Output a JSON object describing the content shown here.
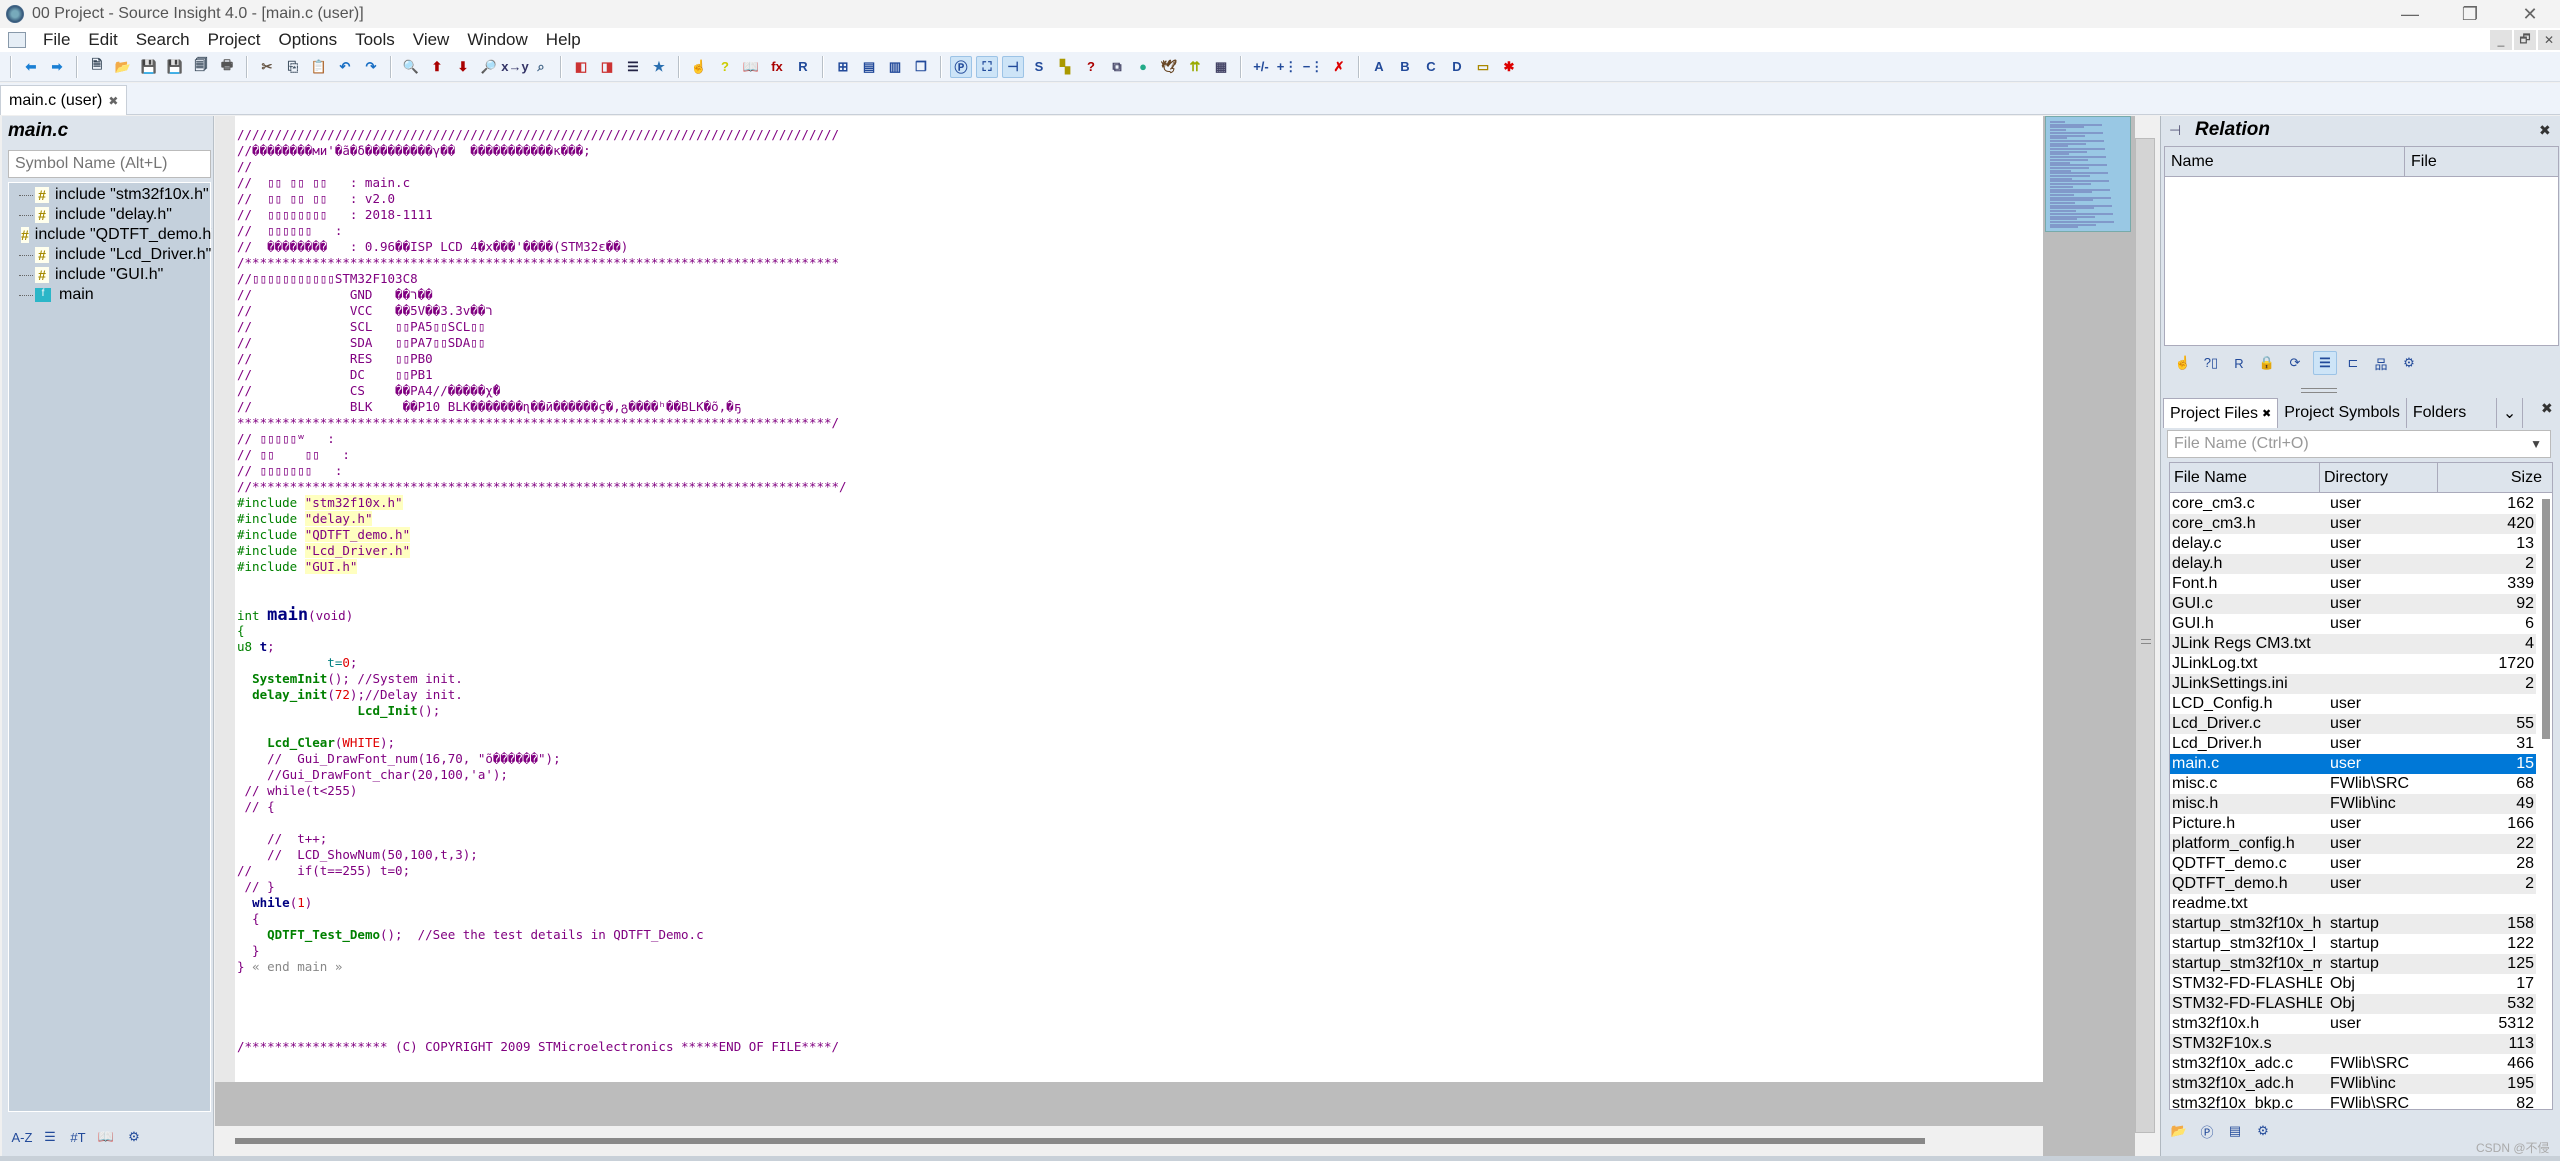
{
  "window": {
    "title": "00 Project - Source Insight 4.0 - [main.c (user)]",
    "controls": {
      "minimize": "—",
      "restore": "❐",
      "close": "✕"
    },
    "mdi_controls": {
      "minimize": "_",
      "restore": "🗗",
      "close": "✕"
    }
  },
  "menu": [
    "File",
    "Edit",
    "Search",
    "Project",
    "Options",
    "Tools",
    "View",
    "Window",
    "Help"
  ],
  "toolbar": {
    "groups": [
      [
        {
          "icon": "back-arrow-icon",
          "glyph": "⬅",
          "color": "#1a7fd4"
        },
        {
          "icon": "forward-arrow-icon",
          "glyph": "➡",
          "color": "#1a7fd4"
        }
      ],
      [
        {
          "icon": "new-file-icon",
          "glyph": "🗎",
          "color": "#345"
        },
        {
          "icon": "open-folder-icon",
          "glyph": "📂",
          "color": "#c90"
        },
        {
          "icon": "save-icon",
          "glyph": "💾",
          "color": "#345"
        },
        {
          "icon": "save-as-icon",
          "glyph": "💾",
          "color": "#a00"
        },
        {
          "icon": "save-all-icon",
          "glyph": "🗐",
          "color": "#345"
        },
        {
          "icon": "print-icon",
          "glyph": "🖶",
          "color": "#555"
        }
      ],
      [
        {
          "icon": "cut-icon",
          "glyph": "✂",
          "color": "#654"
        },
        {
          "icon": "copy-icon",
          "glyph": "⎘",
          "color": "#456"
        },
        {
          "icon": "paste-icon",
          "glyph": "📋",
          "color": "#a80"
        },
        {
          "icon": "undo-icon",
          "glyph": "↶",
          "color": "#1a6fc4"
        },
        {
          "icon": "redo-icon",
          "glyph": "↷",
          "color": "#1a6fc4"
        }
      ],
      [
        {
          "icon": "find-icon",
          "glyph": "🔍",
          "color": "#654"
        },
        {
          "icon": "find-prev-icon",
          "glyph": "⬆",
          "color": "#a00"
        },
        {
          "icon": "find-next-icon",
          "glyph": "⬇",
          "color": "#a00"
        },
        {
          "icon": "search-files-icon",
          "glyph": "🔎",
          "color": "#654"
        },
        {
          "icon": "replace-icon",
          "glyph": "x→y",
          "color": "#336"
        },
        {
          "icon": "search-project-icon",
          "glyph": "⌕",
          "color": "#468"
        }
      ],
      [
        {
          "icon": "bookmark-prev-icon",
          "glyph": "◧",
          "color": "#c33"
        },
        {
          "icon": "bookmark-next-icon",
          "glyph": "◨",
          "color": "#c33"
        },
        {
          "icon": "outline-icon",
          "glyph": "☰",
          "color": "#224"
        },
        {
          "icon": "bookmark-icon",
          "glyph": "★",
          "color": "#2a6fb0"
        }
      ],
      [
        {
          "icon": "jump-to-definition-icon",
          "glyph": "☝",
          "color": "#864"
        },
        {
          "icon": "symbol-info-icon",
          "glyph": "?",
          "color": "#cc0"
        },
        {
          "icon": "browse-icon",
          "glyph": "📖",
          "color": "#654"
        },
        {
          "icon": "function-up-icon",
          "glyph": "fx",
          "color": "#a00"
        },
        {
          "icon": "references-icon",
          "glyph": "R",
          "color": "#224a9a"
        }
      ],
      [
        {
          "icon": "layout-1-icon",
          "glyph": "⊞",
          "color": "#224a9a"
        },
        {
          "icon": "layout-2-icon",
          "glyph": "▤",
          "color": "#224a9a"
        },
        {
          "icon": "layout-3-icon",
          "glyph": "▥",
          "color": "#224a9a"
        },
        {
          "icon": "layout-4-icon",
          "glyph": "❐",
          "color": "#224a9a"
        }
      ],
      [
        {
          "icon": "project-window-icon",
          "glyph": "Ⓟ",
          "color": "#224a9a",
          "active": true
        },
        {
          "icon": "context-window-icon",
          "glyph": "⛶",
          "color": "#224a9a",
          "active": true
        },
        {
          "icon": "relation-window-icon",
          "glyph": "⊣",
          "color": "#224a9a",
          "active": true
        },
        {
          "icon": "symbol-window-icon",
          "glyph": "S",
          "color": "#224a9a"
        },
        {
          "icon": "clip-window-icon",
          "glyph": "▚",
          "color": "#a90"
        },
        {
          "icon": "help-window-icon",
          "glyph": "?",
          "color": "#a00"
        },
        {
          "icon": "overview-icon",
          "glyph": "⧉",
          "color": "#446"
        },
        {
          "icon": "browse-global-icon",
          "glyph": "●",
          "color": "#2a8"
        },
        {
          "icon": "bird-icon",
          "glyph": "🕊",
          "color": "#642"
        },
        {
          "icon": "compare-icon",
          "glyph": "⇈",
          "color": "#9a0"
        },
        {
          "icon": "diff-icon",
          "glyph": "▦",
          "color": "#446"
        }
      ],
      [
        {
          "icon": "expand-collapse-icon",
          "glyph": "+/-",
          "color": "#224a9a"
        },
        {
          "icon": "expand-icon",
          "glyph": "+⋮",
          "color": "#224a9a"
        },
        {
          "icon": "collapse-icon",
          "glyph": "−⋮",
          "color": "#224a9a"
        },
        {
          "icon": "delete-outline-icon",
          "glyph": "✗",
          "color": "#d00"
        }
      ],
      [
        {
          "icon": "bookmark-a-icon",
          "glyph": "A",
          "color": "#224a9a"
        },
        {
          "icon": "bookmark-b-icon",
          "glyph": "B",
          "color": "#224a9a"
        },
        {
          "icon": "bookmark-c-icon",
          "glyph": "C",
          "color": "#224a9a"
        },
        {
          "icon": "bookmark-d-icon",
          "glyph": "D",
          "color": "#224a9a"
        },
        {
          "icon": "folder-bookmark-icon",
          "glyph": "▭",
          "color": "#a80"
        },
        {
          "icon": "folder-bookmark-new-icon",
          "glyph": "✱",
          "color": "#d00"
        }
      ]
    ]
  },
  "tabs": [
    {
      "label": "main.c (user)",
      "close": "✖"
    }
  ],
  "symbol_panel": {
    "title": "main.c",
    "search_placeholder": "Symbol Name (Alt+L)",
    "items": [
      {
        "type": "include",
        "label": "include \"stm32f10x.h\""
      },
      {
        "type": "include",
        "label": "include \"delay.h\""
      },
      {
        "type": "include",
        "label": "include \"QDTFT_demo.h\""
      },
      {
        "type": "include",
        "label": "include \"Lcd_Driver.h\""
      },
      {
        "type": "include",
        "label": "include \"GUI.h\""
      },
      {
        "type": "function",
        "label": "main"
      }
    ],
    "bottom_tools": [
      {
        "icon": "sort-az-icon",
        "glyph": "A-Z"
      },
      {
        "icon": "list-view-icon",
        "glyph": "☰"
      },
      {
        "icon": "symbol-types-icon",
        "glyph": "#T"
      },
      {
        "icon": "browse-book-icon",
        "glyph": "📖"
      },
      {
        "icon": "settings-gear-icon",
        "glyph": "⚙"
      }
    ]
  },
  "editor": {
    "lines": [
      [
        {
          "c": "cmt",
          "t": "////////////////////////////////////////////////////////////////////////////////"
        }
      ],
      [
        {
          "c": "cmt",
          "t": "//��������ми'�ã�δ���������γ��  �����������κ���;"
        }
      ],
      [
        {
          "c": "cmt",
          "t": "//"
        }
      ],
      [
        {
          "c": "cmt",
          "t": "//  ▯▯ ▯▯ ▯▯   : main.c"
        }
      ],
      [
        {
          "c": "cmt",
          "t": "//  ▯▯ ▯▯ ▯▯   : v2.0"
        }
      ],
      [
        {
          "c": "cmt",
          "t": "//  ▯▯▯▯▯▯▯▯   : 2018-1111"
        }
      ],
      [
        {
          "c": "cmt",
          "t": "//  ▯▯▯▯▯▯   :"
        }
      ],
      [
        {
          "c": "cmt",
          "t": "//  ��������   : 0.96��ISP LCD 4�x���'����(STM32ε��)"
        }
      ],
      [
        {
          "c": "cmt",
          "t": "/*******************************************************************************"
        }
      ],
      [
        {
          "c": "cmt",
          "t": "//▯▯▯▯▯▯▯▯▯▯▯STM32F103C8"
        }
      ],
      [
        {
          "c": "cmt",
          "t": "//             GND   ��ר��"
        }
      ],
      [
        {
          "c": "cmt",
          "t": "//             VCC   ��5V��3.3v��ר"
        }
      ],
      [
        {
          "c": "cmt",
          "t": "//             SCL   ▯▯PA5▯▯SCL▯▯"
        }
      ],
      [
        {
          "c": "cmt",
          "t": "//             SDA   ▯▯PA7▯▯SDA▯▯"
        }
      ],
      [
        {
          "c": "cmt",
          "t": "//             RES   ▯▯PB0"
        }
      ],
      [
        {
          "c": "cmt",
          "t": "//             DC    ▯▯PB1"
        }
      ],
      [
        {
          "c": "cmt",
          "t": "//             CS    ��PA4//�����χ̈�"
        }
      ],
      [
        {
          "c": "cmt",
          "t": "//             BLK    ��P10 BLK�������ɳ��ӣ������ç�,გ����ʰ��BLK�õ,�ҕ"
        }
      ],
      [
        {
          "c": "cmt",
          "t": "*******************************************************************************/"
        }
      ],
      [
        {
          "c": "cmt",
          "t": "// ▯▯▯▯▯ʷ   :"
        }
      ],
      [
        {
          "c": "cmt",
          "t": "// ▯▯    ▯▯   :"
        }
      ],
      [
        {
          "c": "cmt",
          "t": "// ▯▯▯▯▯▯▯   :"
        }
      ],
      [
        {
          "c": "cmt",
          "t": "//******************************************************************************/"
        }
      ],
      [
        {
          "c": "pp",
          "t": "#include "
        },
        {
          "c": "str",
          "t": "\"stm32f10x.h\""
        }
      ],
      [
        {
          "c": "pp",
          "t": "#include "
        },
        {
          "c": "str",
          "t": "\"delay.h\""
        }
      ],
      [
        {
          "c": "pp",
          "t": "#include "
        },
        {
          "c": "str",
          "t": "\"QDTFT_demo.h\""
        }
      ],
      [
        {
          "c": "pp",
          "t": "#include "
        },
        {
          "c": "str",
          "t": "\"Lcd_Driver.h\""
        }
      ],
      [
        {
          "c": "pp",
          "t": "#include "
        },
        {
          "c": "str",
          "t": "\"GUI.h\""
        }
      ],
      [
        {
          "c": "cmt",
          "t": ""
        }
      ],
      [
        {
          "c": "cmt",
          "t": ""
        }
      ],
      [
        {
          "c": "kw",
          "t": "int "
        },
        {
          "c": "main",
          "t": "main"
        },
        {
          "c": "cmt",
          "t": "(void)"
        }
      ],
      [
        {
          "c": "kw",
          "t": "{"
        }
      ],
      [
        {
          "c": "kw",
          "t": "u8 "
        },
        {
          "c": "bold",
          "t": "t"
        },
        {
          "c": "cmt",
          "t": ";"
        }
      ],
      [
        {
          "c": "var",
          "t": "            t="
        },
        {
          "c": "num",
          "t": "0"
        },
        {
          "c": "cmt",
          "t": ";"
        }
      ],
      [
        {
          "c": "cmt",
          "t": "  "
        },
        {
          "c": "fn",
          "t": "SystemInit"
        },
        {
          "c": "cmt",
          "t": "(); //System init."
        }
      ],
      [
        {
          "c": "cmt",
          "t": "  "
        },
        {
          "c": "fn",
          "t": "delay_init"
        },
        {
          "c": "cmt",
          "t": "("
        },
        {
          "c": "num",
          "t": "72"
        },
        {
          "c": "cmt",
          "t": ");//Delay init."
        }
      ],
      [
        {
          "c": "cmt",
          "t": "                "
        },
        {
          "c": "fn",
          "t": "Lcd_Init"
        },
        {
          "c": "cmt",
          "t": "();"
        }
      ],
      [
        {
          "c": "cmt",
          "t": ""
        }
      ],
      [
        {
          "c": "cmt",
          "t": "    "
        },
        {
          "c": "fn",
          "t": "Lcd_Clear"
        },
        {
          "c": "cmt",
          "t": "("
        },
        {
          "c": "num",
          "t": "WHITE"
        },
        {
          "c": "cmt",
          "t": ");"
        }
      ],
      [
        {
          "c": "cmt",
          "t": "    //  Gui_DrawFont_num(16,70, \"õ������\");"
        }
      ],
      [
        {
          "c": "cmt",
          "t": "    //Gui_DrawFont_char(20,100,'a');"
        }
      ],
      [
        {
          "c": "cmt",
          "t": " // while(t<255)"
        }
      ],
      [
        {
          "c": "cmt",
          "t": " // {"
        }
      ],
      [
        {
          "c": "cmt",
          "t": ""
        }
      ],
      [
        {
          "c": "cmt",
          "t": "    //  t++;"
        }
      ],
      [
        {
          "c": "cmt",
          "t": "    //  LCD_ShowNum(50,100,t,3);"
        }
      ],
      [
        {
          "c": "cmt",
          "t": "//      if(t==255) t=0;"
        }
      ],
      [
        {
          "c": "cmt",
          "t": " // }"
        }
      ],
      [
        {
          "c": "cmt",
          "t": "  "
        },
        {
          "c": "bold",
          "t": "while"
        },
        {
          "c": "cmt",
          "t": "("
        },
        {
          "c": "num",
          "t": "1"
        },
        {
          "c": "cmt",
          "t": ")"
        }
      ],
      [
        {
          "c": "cmt",
          "t": "  {"
        }
      ],
      [
        {
          "c": "cmt",
          "t": "    "
        },
        {
          "c": "fn",
          "t": "QDTFT_Test_Demo"
        },
        {
          "c": "cmt",
          "t": "();  //See the test details in QDTFT_Demo.c"
        }
      ],
      [
        {
          "c": "cmt",
          "t": "  }"
        }
      ],
      [
        {
          "c": "cmt",
          "t": "} "
        },
        {
          "c": "end",
          "t": "« end main »"
        }
      ],
      [
        {
          "c": "cmt",
          "t": ""
        }
      ],
      [
        {
          "c": "cmt",
          "t": ""
        }
      ],
      [
        {
          "c": "cmt",
          "t": ""
        }
      ],
      [
        {
          "c": "cmt",
          "t": ""
        }
      ],
      [
        {
          "c": "cmt",
          "t": "/******************* (C) COPYRIGHT 2009 STMicroelectronics *****END OF FILE****/"
        }
      ]
    ]
  },
  "relation_panel": {
    "title": "Relation",
    "close": "✖",
    "columns": [
      "Name",
      "File"
    ],
    "tools": [
      {
        "icon": "jump-icon",
        "glyph": "☝"
      },
      {
        "icon": "symbol-info-icon",
        "glyph": "?▯"
      },
      {
        "icon": "references-icon",
        "glyph": "R"
      },
      {
        "icon": "lock-icon",
        "glyph": "🔒"
      },
      {
        "icon": "refresh-icon",
        "glyph": "⟳"
      },
      {
        "icon": "outline-view-icon",
        "glyph": "☰",
        "active": true
      },
      {
        "icon": "horizontal-graph-icon",
        "glyph": "⊏"
      },
      {
        "icon": "vertical-graph-icon",
        "glyph": "品"
      },
      {
        "icon": "settings-gear-icon",
        "glyph": "⚙"
      }
    ]
  },
  "project_panel": {
    "tabs": [
      {
        "label": "Project Files",
        "close": "✖",
        "active": true
      },
      {
        "label": "Project Symbols"
      },
      {
        "label": "Folders"
      }
    ],
    "tabs_dropdown": "⌄",
    "close": "✖",
    "search_placeholder": "File Name (Ctrl+O)",
    "columns": [
      "File Name",
      "Directory",
      "Size"
    ],
    "files": [
      {
        "name": "core_cm3.c",
        "dir": "user",
        "size": "162"
      },
      {
        "name": "core_cm3.h",
        "dir": "user",
        "size": "420"
      },
      {
        "name": "delay.c",
        "dir": "user",
        "size": "13"
      },
      {
        "name": "delay.h",
        "dir": "user",
        "size": "2"
      },
      {
        "name": "Font.h",
        "dir": "user",
        "size": "339"
      },
      {
        "name": "GUI.c",
        "dir": "user",
        "size": "92"
      },
      {
        "name": "GUI.h",
        "dir": "user",
        "size": "6"
      },
      {
        "name": "JLink Regs CM3.txt",
        "dir": "",
        "size": "4"
      },
      {
        "name": "JLinkLog.txt",
        "dir": "",
        "size": "1720"
      },
      {
        "name": "JLinkSettings.ini",
        "dir": "",
        "size": "2"
      },
      {
        "name": "LCD_Config.h",
        "dir": "user",
        "size": ""
      },
      {
        "name": "Lcd_Driver.c",
        "dir": "user",
        "size": "55"
      },
      {
        "name": "Lcd_Driver.h",
        "dir": "user",
        "size": "31"
      },
      {
        "name": "main.c",
        "dir": "user",
        "size": "15",
        "selected": true
      },
      {
        "name": "misc.c",
        "dir": "FWlib\\SRC",
        "size": "68"
      },
      {
        "name": "misc.h",
        "dir": "FWlib\\inc",
        "size": "49"
      },
      {
        "name": "Picture.h",
        "dir": "user",
        "size": "166"
      },
      {
        "name": "platform_config.h",
        "dir": "user",
        "size": "22"
      },
      {
        "name": "QDTFT_demo.c",
        "dir": "user",
        "size": "28"
      },
      {
        "name": "QDTFT_demo.h",
        "dir": "user",
        "size": "2"
      },
      {
        "name": "readme.txt",
        "dir": "",
        "size": ""
      },
      {
        "name": "startup_stm32f10x_h",
        "dir": "startup",
        "size": "158"
      },
      {
        "name": "startup_stm32f10x_l",
        "dir": "startup",
        "size": "122"
      },
      {
        "name": "startup_stm32f10x_m",
        "dir": "startup",
        "size": "125"
      },
      {
        "name": "STM32-FD-FLASHLE",
        "dir": "Obj",
        "size": "17"
      },
      {
        "name": "STM32-FD-FLASHLE",
        "dir": "Obj",
        "size": "532"
      },
      {
        "name": "stm32f10x.h",
        "dir": "user",
        "size": "5312"
      },
      {
        "name": "STM32F10x.s",
        "dir": "",
        "size": "113"
      },
      {
        "name": "stm32f10x_adc.c",
        "dir": "FWlib\\SRC",
        "size": "466"
      },
      {
        "name": "stm32f10x_adc.h",
        "dir": "FWlib\\inc",
        "size": "195"
      },
      {
        "name": "stm32f10x_bkp.c",
        "dir": "FWlib\\SRC",
        "size": "82"
      }
    ],
    "bottom_tools": [
      {
        "icon": "open-project-icon",
        "glyph": "📂"
      },
      {
        "icon": "add-project-file-icon",
        "glyph": "Ⓟ"
      },
      {
        "icon": "file-list-icon",
        "glyph": "▤"
      },
      {
        "icon": "settings-gear-icon",
        "glyph": "⚙"
      }
    ]
  },
  "watermark": "CSDN @不侵",
  "colors": {
    "selection": "#0078d7",
    "comment": "#800080",
    "preprocessor": "#008000",
    "number": "#e00000"
  }
}
